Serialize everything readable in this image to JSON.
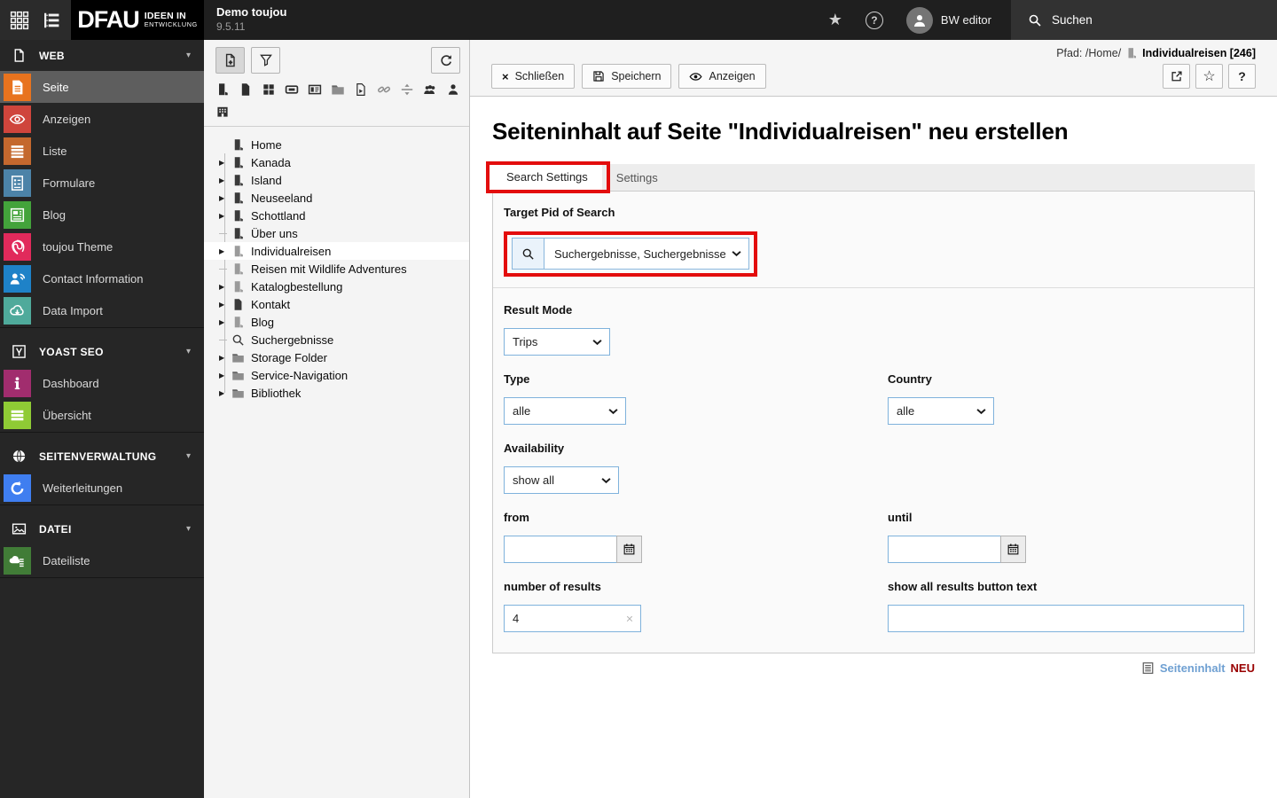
{
  "topbar": {
    "logo_text": "DFAU",
    "logo_sub1": "IDEEN IN",
    "logo_sub2": "ENTWICKLUNG",
    "site_name": "Demo toujou",
    "version": "9.5.11",
    "help_glyph": "?",
    "user_name": "BW editor",
    "search_label": "Suchen"
  },
  "sidebar": {
    "sections": [
      {
        "label": "WEB",
        "icon": "web-doc-icon",
        "items": [
          {
            "label": "Seite",
            "icon": "mod-doc-lines",
            "color": "#e8731e",
            "selected": true
          },
          {
            "label": "Anzeigen",
            "icon": "mod-eye",
            "color": "#cf453c",
            "selected": false
          },
          {
            "label": "Liste",
            "icon": "mod-list",
            "color": "#c4682e",
            "selected": false
          },
          {
            "label": "Formulare",
            "icon": "mod-form",
            "color": "#4c83a8",
            "selected": false
          },
          {
            "label": "Blog",
            "icon": "mod-blog",
            "color": "#43a33b",
            "selected": false
          },
          {
            "label": "toujou Theme",
            "icon": "mod-fingerprint",
            "color": "#e12a5b",
            "selected": false
          },
          {
            "label": "Contact Information",
            "icon": "mod-contact",
            "color": "#1e82c8",
            "selected": false
          },
          {
            "label": "Data Import",
            "icon": "mod-cloud-down",
            "color": "#4faa9b",
            "selected": false
          }
        ]
      },
      {
        "label": "YOAST SEO",
        "icon": "yoast-icon",
        "items": [
          {
            "label": "Dashboard",
            "icon": "mod-info",
            "color": "#a12d6e",
            "selected": false
          },
          {
            "label": "Übersicht",
            "icon": "mod-bars",
            "color": "#8fcb35",
            "selected": false
          }
        ]
      },
      {
        "label": "SEITENVERWALTUNG",
        "icon": "globe-icon",
        "items": [
          {
            "label": "Weiterleitungen",
            "icon": "mod-redo",
            "color": "#3f7ef0",
            "selected": false
          }
        ]
      },
      {
        "label": "DATEI",
        "icon": "image-icon",
        "items": [
          {
            "label": "Dateiliste",
            "icon": "mod-filelist",
            "color": "#417c37",
            "selected": false
          }
        ]
      }
    ]
  },
  "tree_toolbar": {
    "type_icons": [
      "door-page",
      "doc-solid",
      "grid4",
      "banner",
      "mediabox",
      "folder-gray",
      "shortcut-doc",
      "chain-gray",
      "divider-gray",
      "group",
      "person"
    ],
    "type_icons_row3": [
      "building"
    ]
  },
  "tree": {
    "items": [
      {
        "label": "Home",
        "icon": "door-page",
        "gray": false,
        "expand": false,
        "dash": false,
        "selected": false
      },
      {
        "label": "Kanada",
        "icon": "door-page",
        "gray": false,
        "expand": true,
        "dash": false,
        "selected": false
      },
      {
        "label": "Island",
        "icon": "door-page",
        "gray": false,
        "expand": true,
        "dash": false,
        "selected": false
      },
      {
        "label": "Neuseeland",
        "icon": "door-page",
        "gray": false,
        "expand": true,
        "dash": false,
        "selected": false
      },
      {
        "label": "Schottland",
        "icon": "door-page",
        "gray": false,
        "expand": true,
        "dash": false,
        "selected": false
      },
      {
        "label": "Über uns",
        "icon": "door-page",
        "gray": false,
        "expand": false,
        "dash": true,
        "selected": false
      },
      {
        "label": "Individualreisen",
        "icon": "door-page",
        "gray": true,
        "expand": true,
        "dash": false,
        "selected": true
      },
      {
        "label": "Reisen mit Wildlife Adventures",
        "icon": "door-page",
        "gray": true,
        "expand": false,
        "dash": true,
        "selected": false
      },
      {
        "label": "Katalogbestellung",
        "icon": "door-page",
        "gray": true,
        "expand": true,
        "dash": false,
        "selected": false
      },
      {
        "label": "Kontakt",
        "icon": "doc-solid",
        "gray": false,
        "expand": true,
        "dash": false,
        "selected": false
      },
      {
        "label": "Blog",
        "icon": "door-page",
        "gray": true,
        "expand": true,
        "dash": false,
        "selected": false
      },
      {
        "label": "Suchergebnisse",
        "icon": "magnifier-dark",
        "gray": false,
        "expand": false,
        "dash": true,
        "selected": false
      },
      {
        "label": "Storage Folder",
        "icon": "folder",
        "gray": false,
        "expand": true,
        "dash": false,
        "selected": false
      },
      {
        "label": "Service-Navigation",
        "icon": "folder",
        "gray": false,
        "expand": true,
        "dash": false,
        "selected": false
      },
      {
        "label": "Bibliothek",
        "icon": "folder",
        "gray": false,
        "expand": true,
        "dash": false,
        "selected": false
      }
    ]
  },
  "docheader": {
    "path_prefix": "Pfad: /Home/",
    "record": "Individualreisen [246]",
    "close_label": "Schließen",
    "save_label": "Speichern",
    "view_label": "Anzeigen",
    "help_glyph": "?",
    "star_glyph": "☆"
  },
  "page": {
    "title": "Seiteninhalt auf Seite \"Individualreisen\" neu erstellen",
    "tabs": {
      "search_settings": "Search Settings",
      "settings": "Settings"
    },
    "form": {
      "target_pid": {
        "label": "Target Pid of Search",
        "value": "Suchergebnisse, Suchergebnisse"
      },
      "result_mode": {
        "label": "Result Mode",
        "value": "Trips"
      },
      "type": {
        "label": "Type",
        "value": "alle"
      },
      "country": {
        "label": "Country",
        "value": "alle"
      },
      "availability": {
        "label": "Availability",
        "value": "show all"
      },
      "from": {
        "label": "from",
        "value": ""
      },
      "until": {
        "label": "until",
        "value": ""
      },
      "number_of_results": {
        "label": "number of results",
        "value": "4",
        "clear_glyph": "×"
      },
      "show_all_text": {
        "label": "show all results button text",
        "value": ""
      }
    },
    "footer": {
      "record_type": "Seiteninhalt",
      "state": "NEU"
    }
  },
  "annotation_color": "#e30d0d"
}
